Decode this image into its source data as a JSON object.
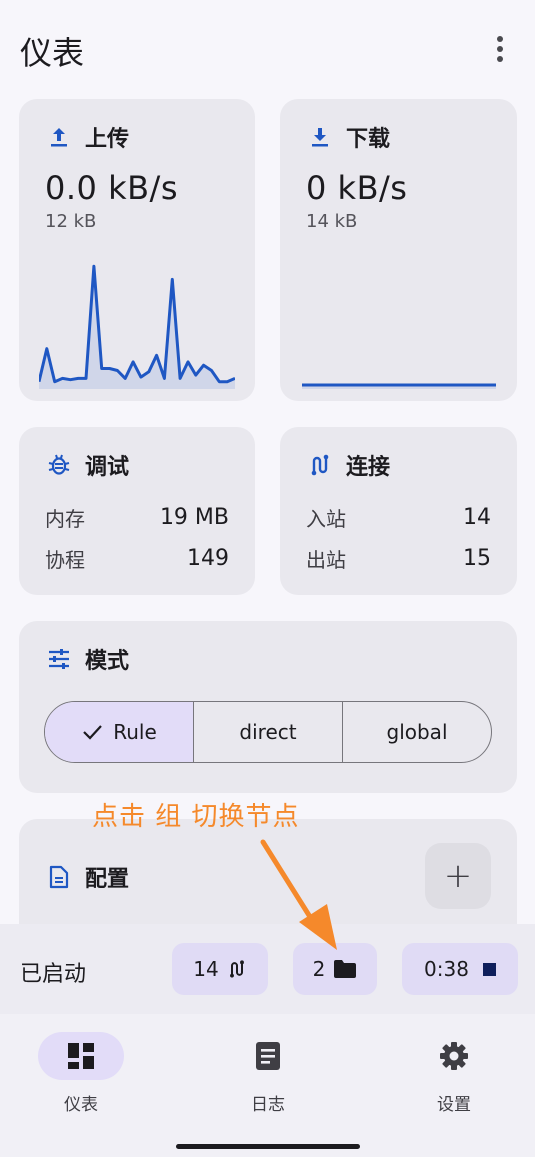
{
  "header": {
    "title": "仪表",
    "more_icon": "more-vert-icon"
  },
  "upload": {
    "title": "上传",
    "speed": "0.0 kB/s",
    "total": "12 kB",
    "icon": "upload-icon"
  },
  "download": {
    "title": "下载",
    "speed": "0 kB/s",
    "total": "14 kB",
    "icon": "download-icon"
  },
  "debug": {
    "title": "调试",
    "icon": "bug-icon",
    "rows": [
      {
        "label": "内存",
        "value": "19 MB"
      },
      {
        "label": "协程",
        "value": "149"
      }
    ]
  },
  "connections": {
    "title": "连接",
    "icon": "connection-icon",
    "rows": [
      {
        "label": "入站",
        "value": "14"
      },
      {
        "label": "出站",
        "value": "15"
      }
    ]
  },
  "mode": {
    "title": "模式",
    "icon": "tune-icon",
    "options": [
      "Rule",
      "direct",
      "global"
    ],
    "selected": "Rule"
  },
  "annotation": "点击 组 切换节点",
  "config": {
    "title": "配置",
    "icon": "document-icon",
    "add_label": "+"
  },
  "status": {
    "text": "已启动",
    "connections_chip": "14",
    "groups_chip": "2",
    "timer_chip": "0:38"
  },
  "nav": [
    {
      "label": "仪表",
      "icon": "dashboard-icon",
      "active": true
    },
    {
      "label": "日志",
      "icon": "log-icon",
      "active": false
    },
    {
      "label": "设置",
      "icon": "settings-icon",
      "active": false
    }
  ],
  "colors": {
    "accent": "#1f57c3",
    "annotation": "#f5892b",
    "chip_bg": "#e0dbf5"
  },
  "chart_data": [
    {
      "type": "area",
      "series": [
        {
          "values": [
            0.05,
            0.55,
            0.05,
            0.1,
            0.08,
            0.1,
            0.1,
            1.8,
            0.25,
            0.25,
            0.22,
            0.1,
            0.35,
            0.12,
            0.2,
            0.45,
            0.1,
            1.6,
            0.1,
            0.35,
            0.15,
            0.3,
            0.22,
            0.05,
            0.05,
            0.1
          ]
        }
      ],
      "ylim": [
        0,
        2
      ]
    },
    {
      "type": "area",
      "series": [
        {
          "values": [
            0,
            0,
            0,
            0,
            0,
            0,
            0,
            0,
            0,
            0,
            0,
            0,
            0,
            0,
            0,
            0,
            0,
            0,
            0,
            0,
            0,
            0,
            0,
            0,
            0,
            0
          ]
        }
      ],
      "ylim": [
        0,
        2
      ]
    }
  ]
}
